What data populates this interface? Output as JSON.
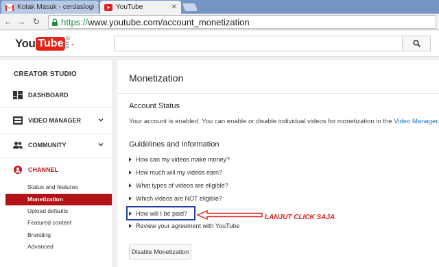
{
  "browser": {
    "tabs": [
      {
        "title": "Kotak Masuk - cerdaslogi",
        "active": false
      },
      {
        "title": "YouTube",
        "active": true
      }
    ],
    "url_scheme": "https://",
    "url_rest": "www.youtube.com/account_monetization"
  },
  "header": {
    "logo_you": "You",
    "logo_tube": "Tube",
    "logo_region": "ID"
  },
  "sidebar": {
    "title": "CREATOR STUDIO",
    "items": [
      {
        "label": "DASHBOARD"
      },
      {
        "label": "VIDEO MANAGER"
      },
      {
        "label": "COMMUNITY"
      },
      {
        "label": "CHANNEL"
      }
    ],
    "channel_subitems": [
      {
        "label": "Status and features"
      },
      {
        "label": "Monetization"
      },
      {
        "label": "Upload defaults"
      },
      {
        "label": "Featured content"
      },
      {
        "label": "Branding"
      },
      {
        "label": "Advanced"
      }
    ]
  },
  "main": {
    "title": "Monetization",
    "account_status_title": "Account Status",
    "account_status_text": "Your account is enabled. You can enable or disable individual videos for monetization in the ",
    "account_status_link": "Video Manager",
    "account_status_end": ".",
    "guidelines_title": "Guidelines and Information",
    "faqs": [
      "How can my videos make money?",
      "How much will my videos earn?",
      "What types of videos are eligible?",
      "Which videos are NOT eligible?",
      "How will I be paid?",
      "Review your agreement with YouTube"
    ],
    "disable_button": "Disable Monetization"
  },
  "annotation": {
    "text": "LANJUT CLICK SAJA",
    "color": "#e0201b",
    "box_color": "#1f3fa6"
  },
  "colors": {
    "youtube_red": "#e62117",
    "active_item": "#b31217",
    "link": "#167ac6"
  }
}
